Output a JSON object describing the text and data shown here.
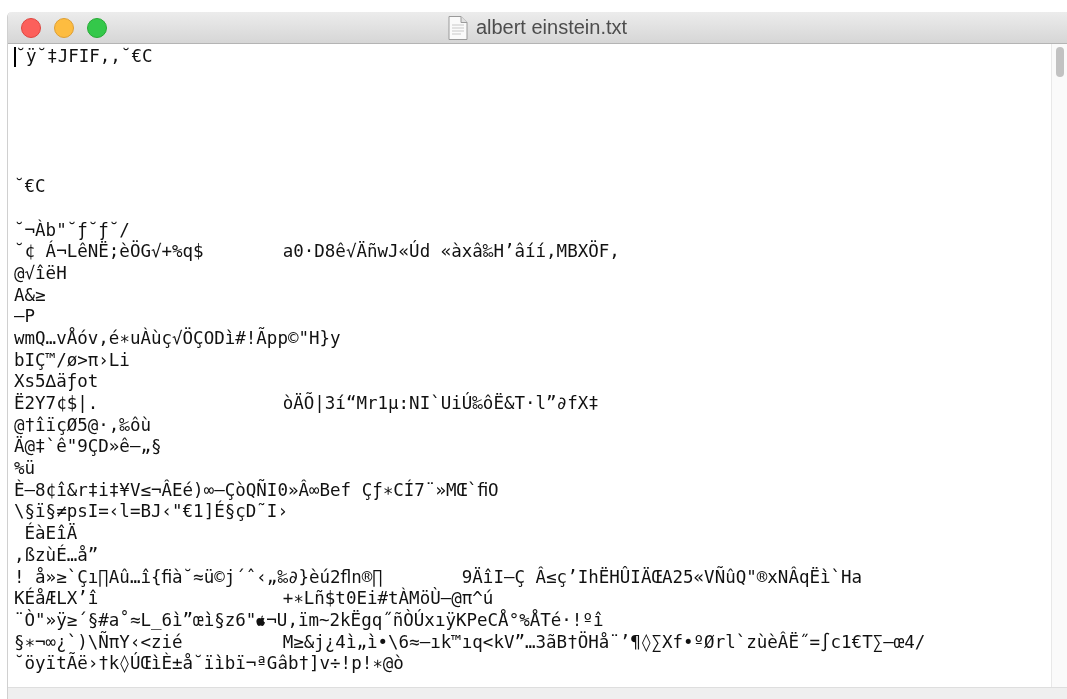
{
  "window": {
    "title": "albert einstein.txt"
  },
  "lines": [
    {
      "kind": "text",
      "cursor": true,
      "text": "˘ÿ˘‡JFIF,,˘€C"
    },
    {
      "kind": "blank"
    },
    {
      "kind": "blank"
    },
    {
      "kind": "blank"
    },
    {
      "kind": "blank"
    },
    {
      "kind": "blank"
    },
    {
      "kind": "text",
      "cursor": false,
      "text": "˘€C"
    },
    {
      "kind": "blank"
    },
    {
      "kind": "text",
      "cursor": false,
      "text": "˘¬Àb\"˘ƒ˘ƒ˘/"
    },
    {
      "kind": "text",
      "cursor": false,
      "text": "˘¢ Á¬LêNË;èÖG√+%q$\ta0·D8ê√ÄñwJ«Úd «àxâ‰H’âíí,MBXÖF,"
    },
    {
      "kind": "text",
      "cursor": false,
      "text": "@√îëH"
    },
    {
      "kind": "text",
      "cursor": false,
      "text": "A&≥"
    },
    {
      "kind": "text",
      "cursor": false,
      "text": "—P"
    },
    {
      "kind": "text",
      "cursor": false,
      "text": "wmQ…vÅóv,é∗uÀùç√ÖÇODì#!Ãpp©\"H}y"
    },
    {
      "kind": "text",
      "cursor": false,
      "text": "bIÇ™/ø>π›Li"
    },
    {
      "kind": "text",
      "cursor": false,
      "text": "Xs5∆äƒot"
    },
    {
      "kind": "text",
      "cursor": false,
      "text": "Ë2Y7¢$|.\t\tòÄÕ|3í“Mr1µ:NI`UiÚ‰ôË&T·l”∂fX‡"
    },
    {
      "kind": "text",
      "cursor": false,
      "text": "@†îïçØ5@·,‰ôù"
    },
    {
      "kind": "text",
      "cursor": false,
      "text": "Ä@‡`ê\"9ÇD»ê–„§"
    },
    {
      "kind": "text",
      "cursor": false,
      "text": "%ü"
    },
    {
      "kind": "text",
      "cursor": false,
      "text": "È–8¢î&r‡i‡¥V≤¬ÂEé)∞–ÇòQÑI0»Â∞Bef Çƒ∗CÍ7¨»MŒ`ﬁO"
    },
    {
      "kind": "text",
      "cursor": false,
      "text": "\\§ï§≠psI=‹l=BJ‹\"€1]É§çD˜I›"
    },
    {
      "kind": "text",
      "cursor": false,
      "text": " ÉàEîÄ"
    },
    {
      "kind": "text",
      "cursor": false,
      "text": ",ßzùÉ…å”"
    },
    {
      "kind": "text",
      "cursor": false,
      "text": "! å»≥`Çı∏Aû…î{ﬁà˘≈ü©j´ˆ‹„‰∂}èú2ﬂn®∏\t9ÄîI–Ç Â≤ç’IhËHÛIÄŒA25«VÑûQ\"®xNÂqËì`Ha"
    },
    {
      "kind": "text",
      "cursor": false,
      "text": "KÉåÆLX’î\t\t+∗Lñ$t0Ei#tÀMöÙ—@π^ú"
    },
    {
      "kind": "mixed",
      "cursor": false,
      "parts": [
        "¨Ò\"»ÿ≥´§#a˚≈L_6ì”œì§z6\"",
        "¬U,ïm~2kËgq˝ñÒÚxıÿKPeCÅ°%ÅTé·!ºî"
      ]
    },
    {
      "kind": "text",
      "cursor": false,
      "text": "§∗¬∞¿`)\\ÑπY‹<zié\t\tM≥&j¿4ì„ì•\\6≈–ık™ıq<kV”…3ãB†ÖHå¨’¶◊∑Xf•ºØrl`zùèÂË˝=∫c1€T∑–œ4/"
    },
    {
      "kind": "text",
      "cursor": false,
      "text": "˘öyïtÃë›†k◊ÚŒìÈ±å˘ïìbï¬ªGâb†]v÷!p!∗@ò"
    }
  ]
}
